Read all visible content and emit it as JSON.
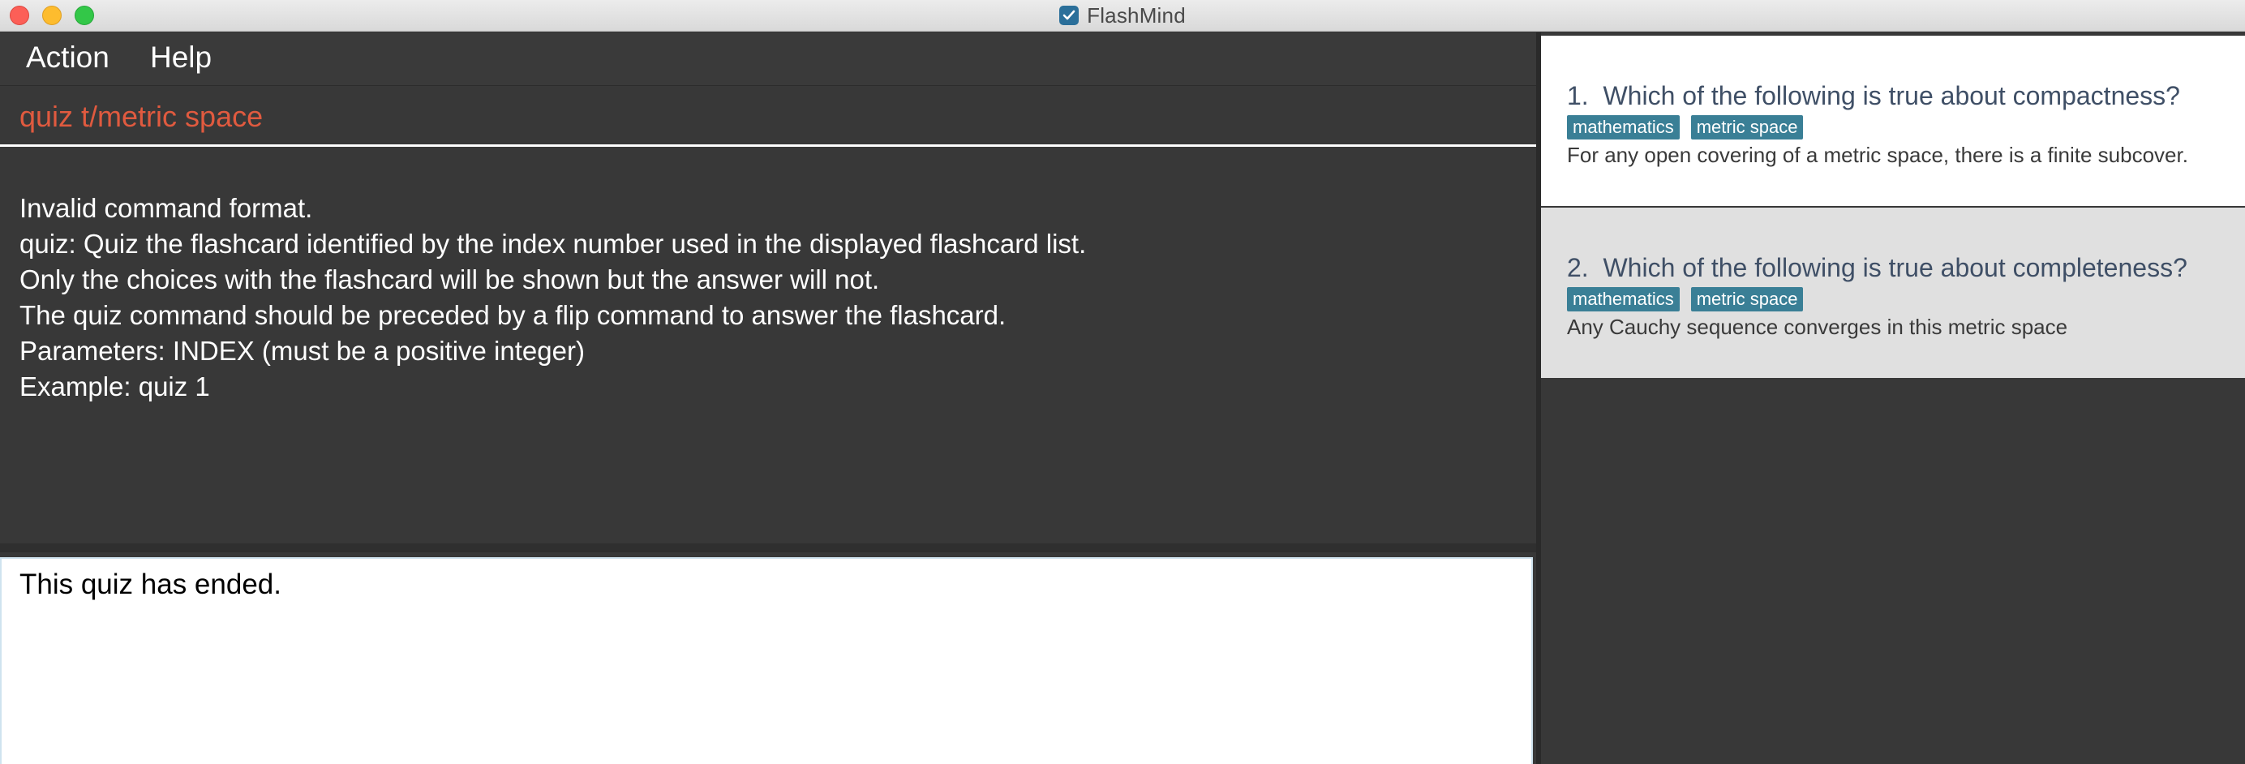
{
  "window": {
    "title": "FlashMind",
    "app_icon": "flashmind-app-icon"
  },
  "menu": {
    "items": [
      {
        "label": "Action"
      },
      {
        "label": "Help"
      }
    ]
  },
  "command_box": {
    "value": "quiz t/metric space",
    "text_color": "#e05a3f"
  },
  "result_display": {
    "lines": [
      "Invalid command format.",
      "quiz: Quiz the flashcard identified by the index number used in the displayed flashcard list.",
      "Only the choices with the flashcard will be shown but the answer will not.",
      "The quiz command should be preceded by a flip command to answer the flashcard.",
      "Parameters: INDEX (must be a positive integer)",
      "Example: quiz 1"
    ]
  },
  "quiz_panel": {
    "text": "This quiz has ended."
  },
  "flashcards": [
    {
      "number": "1.",
      "question": "Which of the following is true about compactness?",
      "tags": [
        "mathematics",
        "metric space"
      ],
      "answer": "For any open covering of a metric space, there is a finite subcover."
    },
    {
      "number": "2.",
      "question": "Which of the following is true about completeness?",
      "tags": [
        "mathematics",
        "metric space"
      ],
      "answer": "Any Cauchy sequence converges in this metric space"
    }
  ],
  "colors": {
    "background": "#383838",
    "tag": "#3a7f96",
    "question": "#3f4f66",
    "selected_card": "#ffffff",
    "unselected_card": "#e0e0e0"
  }
}
